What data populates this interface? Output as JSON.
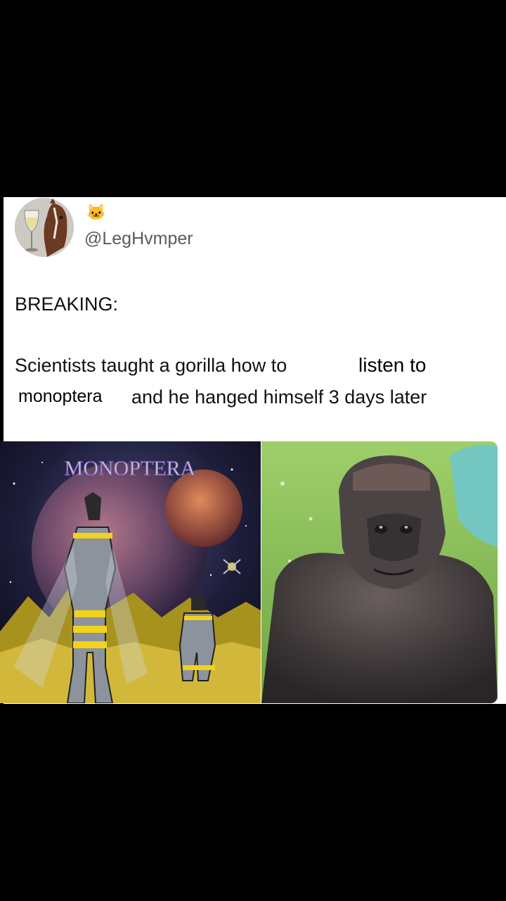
{
  "post": {
    "emoji": "🐱",
    "handle": "@LegHvmper",
    "line1": "BREAKING:",
    "line2_prefix": "Scientists taught a gorilla how to",
    "overlay_word1": "listen to",
    "overlay_word2": "monoptera",
    "line3_suffix": "and he hanged himself 3 days later"
  },
  "media": {
    "left_logo": "MONOPTERA",
    "left_image": "album-cover-art",
    "right_image": "gorilla-photo"
  },
  "colors": {
    "background": "#000000",
    "card": "#ffffff",
    "text": "#111111",
    "handle": "#5b5b5b"
  }
}
